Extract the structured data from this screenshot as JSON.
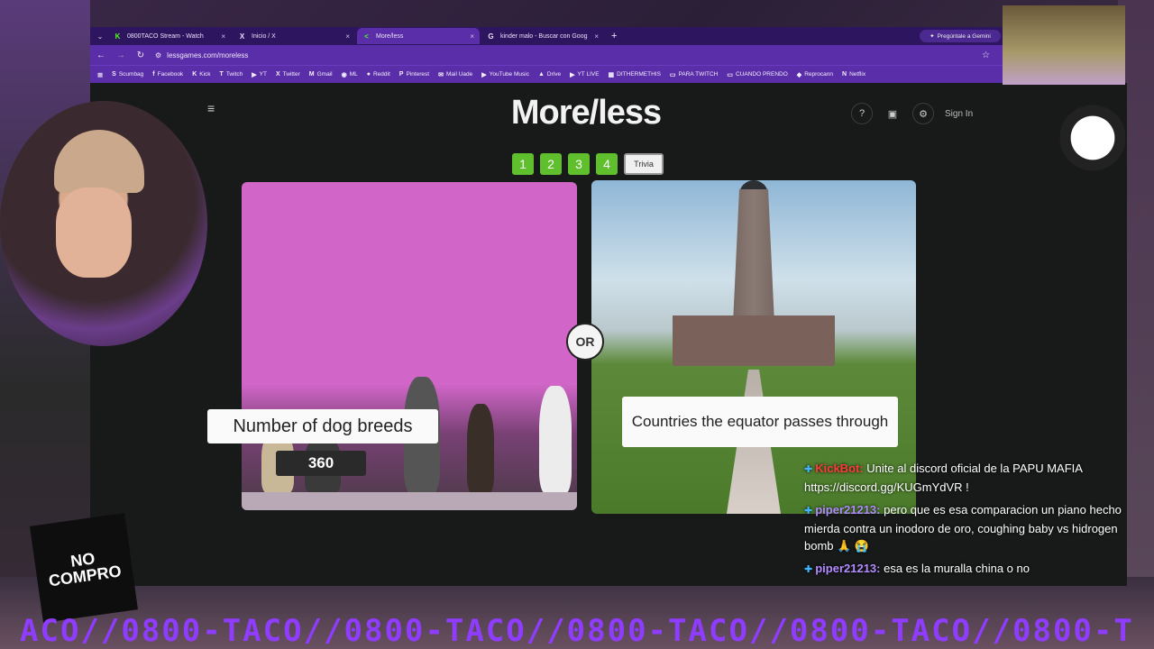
{
  "browser": {
    "tabs": [
      {
        "label": "0800TACO Stream - Watch",
        "icon": "K",
        "color": "#53fc18",
        "active": false
      },
      {
        "label": "Inicio / X",
        "icon": "X",
        "color": "#ffffff",
        "active": false
      },
      {
        "label": "More/less",
        "icon": "<",
        "color": "#53fc18",
        "active": true
      },
      {
        "label": "kinder malo - Buscar con Goog",
        "icon": "G",
        "color": "#ffffff",
        "active": false
      }
    ],
    "new_tab": "+",
    "url": "lessgames.com/moreless",
    "gemini": "Pregúntale a Gemini",
    "bookmarks": [
      {
        "label": "Scumbag",
        "icon": "S"
      },
      {
        "label": "Facebook",
        "icon": "f"
      },
      {
        "label": "Kick",
        "icon": "K"
      },
      {
        "label": "Twitch",
        "icon": "T"
      },
      {
        "label": "YT",
        "icon": "▶"
      },
      {
        "label": "Twitter",
        "icon": "X"
      },
      {
        "label": "Gmail",
        "icon": "M"
      },
      {
        "label": "ML",
        "icon": "◉"
      },
      {
        "label": "Reddit",
        "icon": "●"
      },
      {
        "label": "Pinterest",
        "icon": "P"
      },
      {
        "label": "Mail Uade",
        "icon": "✉"
      },
      {
        "label": "YouTube Music",
        "icon": "▶"
      },
      {
        "label": "Drive",
        "icon": "▲"
      },
      {
        "label": "YT LIVE",
        "icon": "▶"
      },
      {
        "label": "DITHERMETHIS",
        "icon": "▦"
      },
      {
        "label": "PARA TWITCH",
        "icon": "▭"
      },
      {
        "label": "CUANDO PRENDO",
        "icon": "▭"
      },
      {
        "label": "Reprocann",
        "icon": "◆"
      },
      {
        "label": "Netflix",
        "icon": "N"
      }
    ]
  },
  "page": {
    "logo": "More/less",
    "signin": "Sign In",
    "help": "?",
    "levels": [
      "1",
      "2",
      "3",
      "4"
    ],
    "trivia": "Trivia",
    "or": "OR",
    "left_card": {
      "label": "Number of dog breeds",
      "value": "360"
    },
    "right_card": {
      "label": "Countries the equator passes through"
    }
  },
  "chat": [
    {
      "user": "KickBot:",
      "user_color": "#ff3b3b",
      "text": "Unite al discord oficial de la PAPU MAFIA https://discord.gg/KUGmYdVR !"
    },
    {
      "user": "piper21213:",
      "user_color": "#b28bff",
      "text": "pero que es esa comparacion un piano hecho mierda contra un inodoro de oro, coughing baby vs hidrogen bomb 🙏 😭"
    },
    {
      "user": "piper21213:",
      "user_color": "#b28bff",
      "text": "esa es la muralla china o no"
    }
  ],
  "overlay": {
    "ticker": "ACO//0800-TACO//0800-TACO//0800-TACO//0800-TACO//0800-T",
    "sticker_text": "NO COMPRO"
  }
}
